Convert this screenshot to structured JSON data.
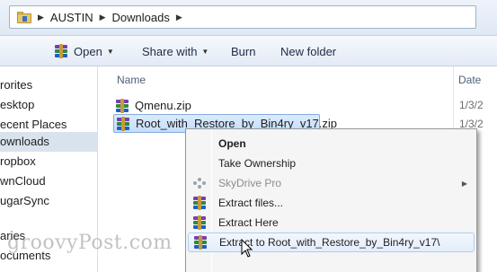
{
  "address_bar": {
    "crumbs": [
      "AUSTIN",
      "Downloads"
    ]
  },
  "toolbar": {
    "open_label": "Open",
    "share_label": "Share with",
    "burn_label": "Burn",
    "new_folder_label": "New folder"
  },
  "nav": {
    "items": [
      "rorites",
      "esktop",
      "ecent Places",
      "ownloads",
      "ropbox",
      "wnCloud",
      "ugarSync",
      "aries",
      "ocuments"
    ]
  },
  "columns": {
    "name": "Name",
    "date": "Date"
  },
  "files": [
    {
      "name": "Qmenu.zip",
      "date": "1/3/2"
    },
    {
      "name": "Root_with_Restore_by_Bin4ry_v17.zip",
      "date": "1/3/2"
    }
  ],
  "context_menu": {
    "items": [
      {
        "label": "Open",
        "icon": "none"
      },
      {
        "label": "Take Ownership",
        "icon": "none"
      },
      {
        "label": "SkyDrive Pro",
        "icon": "skydrive-icon"
      },
      {
        "label": "Extract files...",
        "icon": "winrar-icon"
      },
      {
        "label": "Extract Here",
        "icon": "winrar-icon"
      },
      {
        "label": "Extract to Root_with_Restore_by_Bin4ry_v17\\",
        "icon": "winrar-icon"
      }
    ]
  },
  "watermark": "groovyPost.com"
}
